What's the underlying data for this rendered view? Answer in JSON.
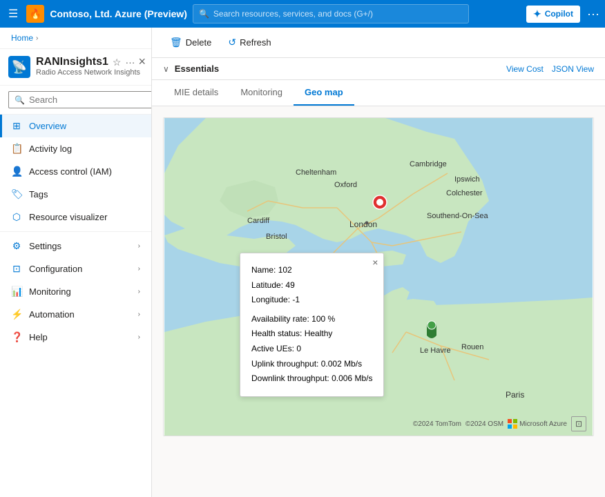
{
  "topbar": {
    "hamburger_label": "☰",
    "title": "Contoso, Ltd. Azure (Preview)",
    "logo_icon": "🔥",
    "search_placeholder": "Search resources, services, and docs (G+/)",
    "copilot_label": "Copilot",
    "dots_label": "···"
  },
  "breadcrumb": {
    "home_label": "Home",
    "arrow": "›"
  },
  "resource": {
    "name": "RANInsights1",
    "subtitle": "Radio Access Network Insights",
    "icon": "📡",
    "star_icon": "☆",
    "more_icon": "···",
    "close_icon": "×"
  },
  "sidebar": {
    "search_placeholder": "Search",
    "nav_items": [
      {
        "id": "overview",
        "label": "Overview",
        "icon": "⊞",
        "active": true,
        "expandable": false
      },
      {
        "id": "activity-log",
        "label": "Activity log",
        "icon": "📋",
        "active": false,
        "expandable": false
      },
      {
        "id": "access-control",
        "label": "Access control (IAM)",
        "icon": "👤",
        "active": false,
        "expandable": false
      },
      {
        "id": "tags",
        "label": "Tags",
        "icon": "🏷",
        "active": false,
        "expandable": false
      },
      {
        "id": "resource-visualizer",
        "label": "Resource visualizer",
        "icon": "⬡",
        "active": false,
        "expandable": false
      },
      {
        "id": "settings",
        "label": "Settings",
        "icon": "",
        "active": false,
        "expandable": true
      },
      {
        "id": "configuration",
        "label": "Configuration",
        "icon": "",
        "active": false,
        "expandable": true
      },
      {
        "id": "monitoring",
        "label": "Monitoring",
        "icon": "",
        "active": false,
        "expandable": true
      },
      {
        "id": "automation",
        "label": "Automation",
        "icon": "",
        "active": false,
        "expandable": true
      },
      {
        "id": "help",
        "label": "Help",
        "icon": "",
        "active": false,
        "expandable": true
      }
    ]
  },
  "toolbar": {
    "delete_label": "Delete",
    "refresh_label": "Refresh",
    "delete_icon": "🗑",
    "refresh_icon": "↺"
  },
  "essentials": {
    "label": "Essentials",
    "view_cost_label": "View Cost",
    "json_view_label": "JSON View"
  },
  "tabs": [
    {
      "id": "mie-details",
      "label": "MIE details",
      "active": false
    },
    {
      "id": "monitoring",
      "label": "Monitoring",
      "active": false
    },
    {
      "id": "geo-map",
      "label": "Geo map",
      "active": true
    }
  ],
  "map": {
    "popup": {
      "name_label": "Name:",
      "name_value": "102",
      "latitude_label": "Latitude:",
      "latitude_value": "49",
      "longitude_label": "Longitude:",
      "longitude_value": "-1",
      "availability_label": "Availability rate:",
      "availability_value": "100 %",
      "health_label": "Health status:",
      "health_value": "Healthy",
      "active_ues_label": "Active UEs:",
      "active_ues_value": "0",
      "uplink_label": "Uplink throughput:",
      "uplink_value": "0.002 Mb/s",
      "downlink_label": "Downlink throughput:",
      "downlink_value": "0.006 Mb/s",
      "close_icon": "×"
    },
    "footer": {
      "tomtom": "©2024 TomTom",
      "osm": "©2024 OSM",
      "azure": "Microsoft Azure"
    }
  }
}
